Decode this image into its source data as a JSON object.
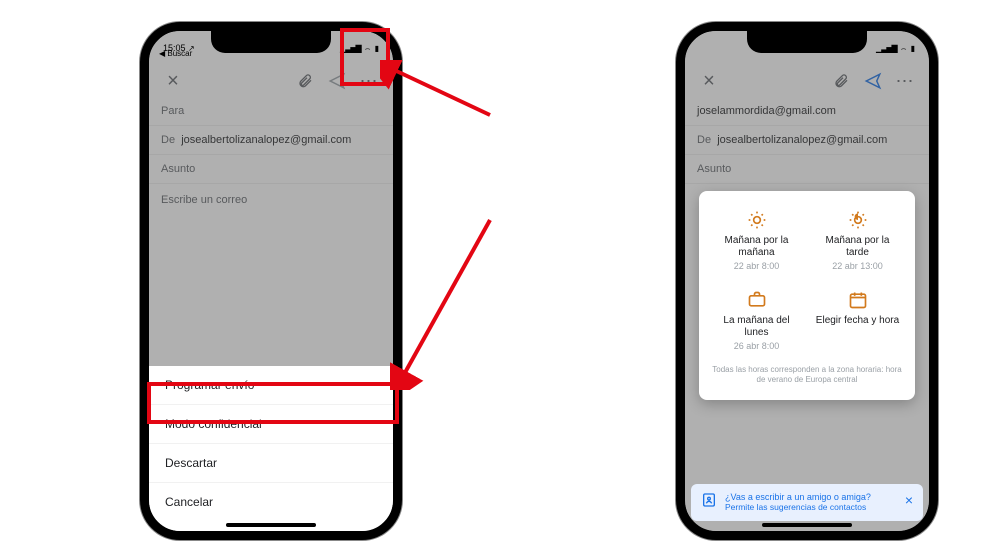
{
  "colors": {
    "accent_blue": "#1a73e8",
    "accent_orange": "#d27a1d",
    "annotation_red": "#e30613"
  },
  "statusbar": {
    "left_time": "15:05",
    "left_back": "◀ Buscar"
  },
  "compose": {
    "to_label": "Para",
    "from_label": "De",
    "from_value_left": "josealbertolizanalopez@gmail.com",
    "to_value_right": "joselammordida@gmail.com",
    "from_value_right": "josealbertolizanalopez@gmail.com",
    "subject_label": "Asunto",
    "body_placeholder": "Escribe un correo"
  },
  "sheet": {
    "items": [
      "Programar envío",
      "Modo confidencial",
      "Descartar",
      "Cancelar"
    ]
  },
  "schedule": {
    "options": [
      {
        "title": "Mañana por la mañana",
        "sub": "22 abr 8:00"
      },
      {
        "title": "Mañana por la tarde",
        "sub": "22 abr 13:00"
      },
      {
        "title": "La mañana del lunes",
        "sub": "26 abr 8:00"
      },
      {
        "title": "Elegir fecha y hora",
        "sub": ""
      }
    ],
    "tz": "Todas las horas corresponden a la zona horaria: hora de verano de Europa central"
  },
  "suggest": {
    "title": "¿Vas a escribir a un amigo o amiga?",
    "sub": "Permite las sugerencias de contactos"
  }
}
